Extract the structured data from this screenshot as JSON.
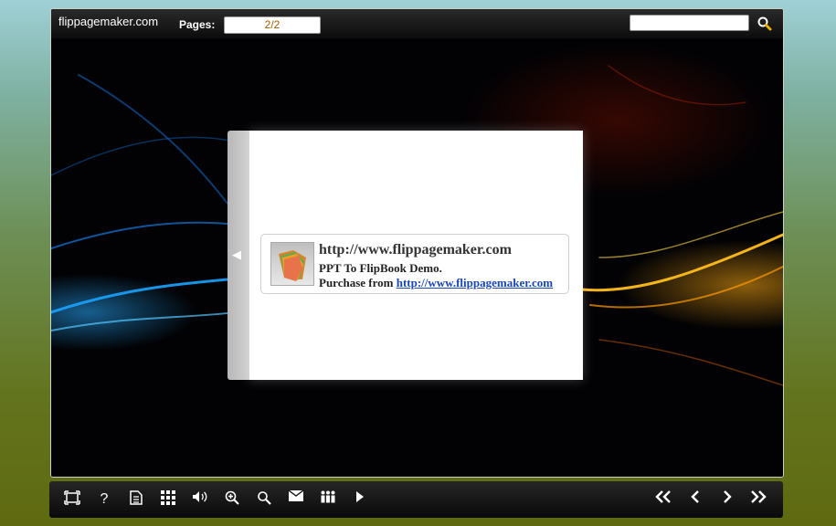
{
  "app": {
    "brand": "flippagemaker.com"
  },
  "header": {
    "pages_label": "Pages:",
    "pages_value": "2/2",
    "search_value": ""
  },
  "page": {
    "card_title": "http://www.flippagemaker.com",
    "card_line2": "PPT To FlipBook Demo.",
    "card_line3_prefix": "Purchase from",
    "card_link": "http://www.flippagemaker.com"
  },
  "toolbar": {
    "icons": [
      "fullscreen-icon",
      "help-icon",
      "print-icon",
      "thumbnails-icon",
      "sound-icon",
      "zoom-in-icon",
      "search-icon",
      "email-icon",
      "share-icon",
      "autoplay-icon"
    ],
    "nav_icons": [
      "first-page-icon",
      "prev-page-icon",
      "next-page-icon",
      "last-page-icon"
    ]
  }
}
